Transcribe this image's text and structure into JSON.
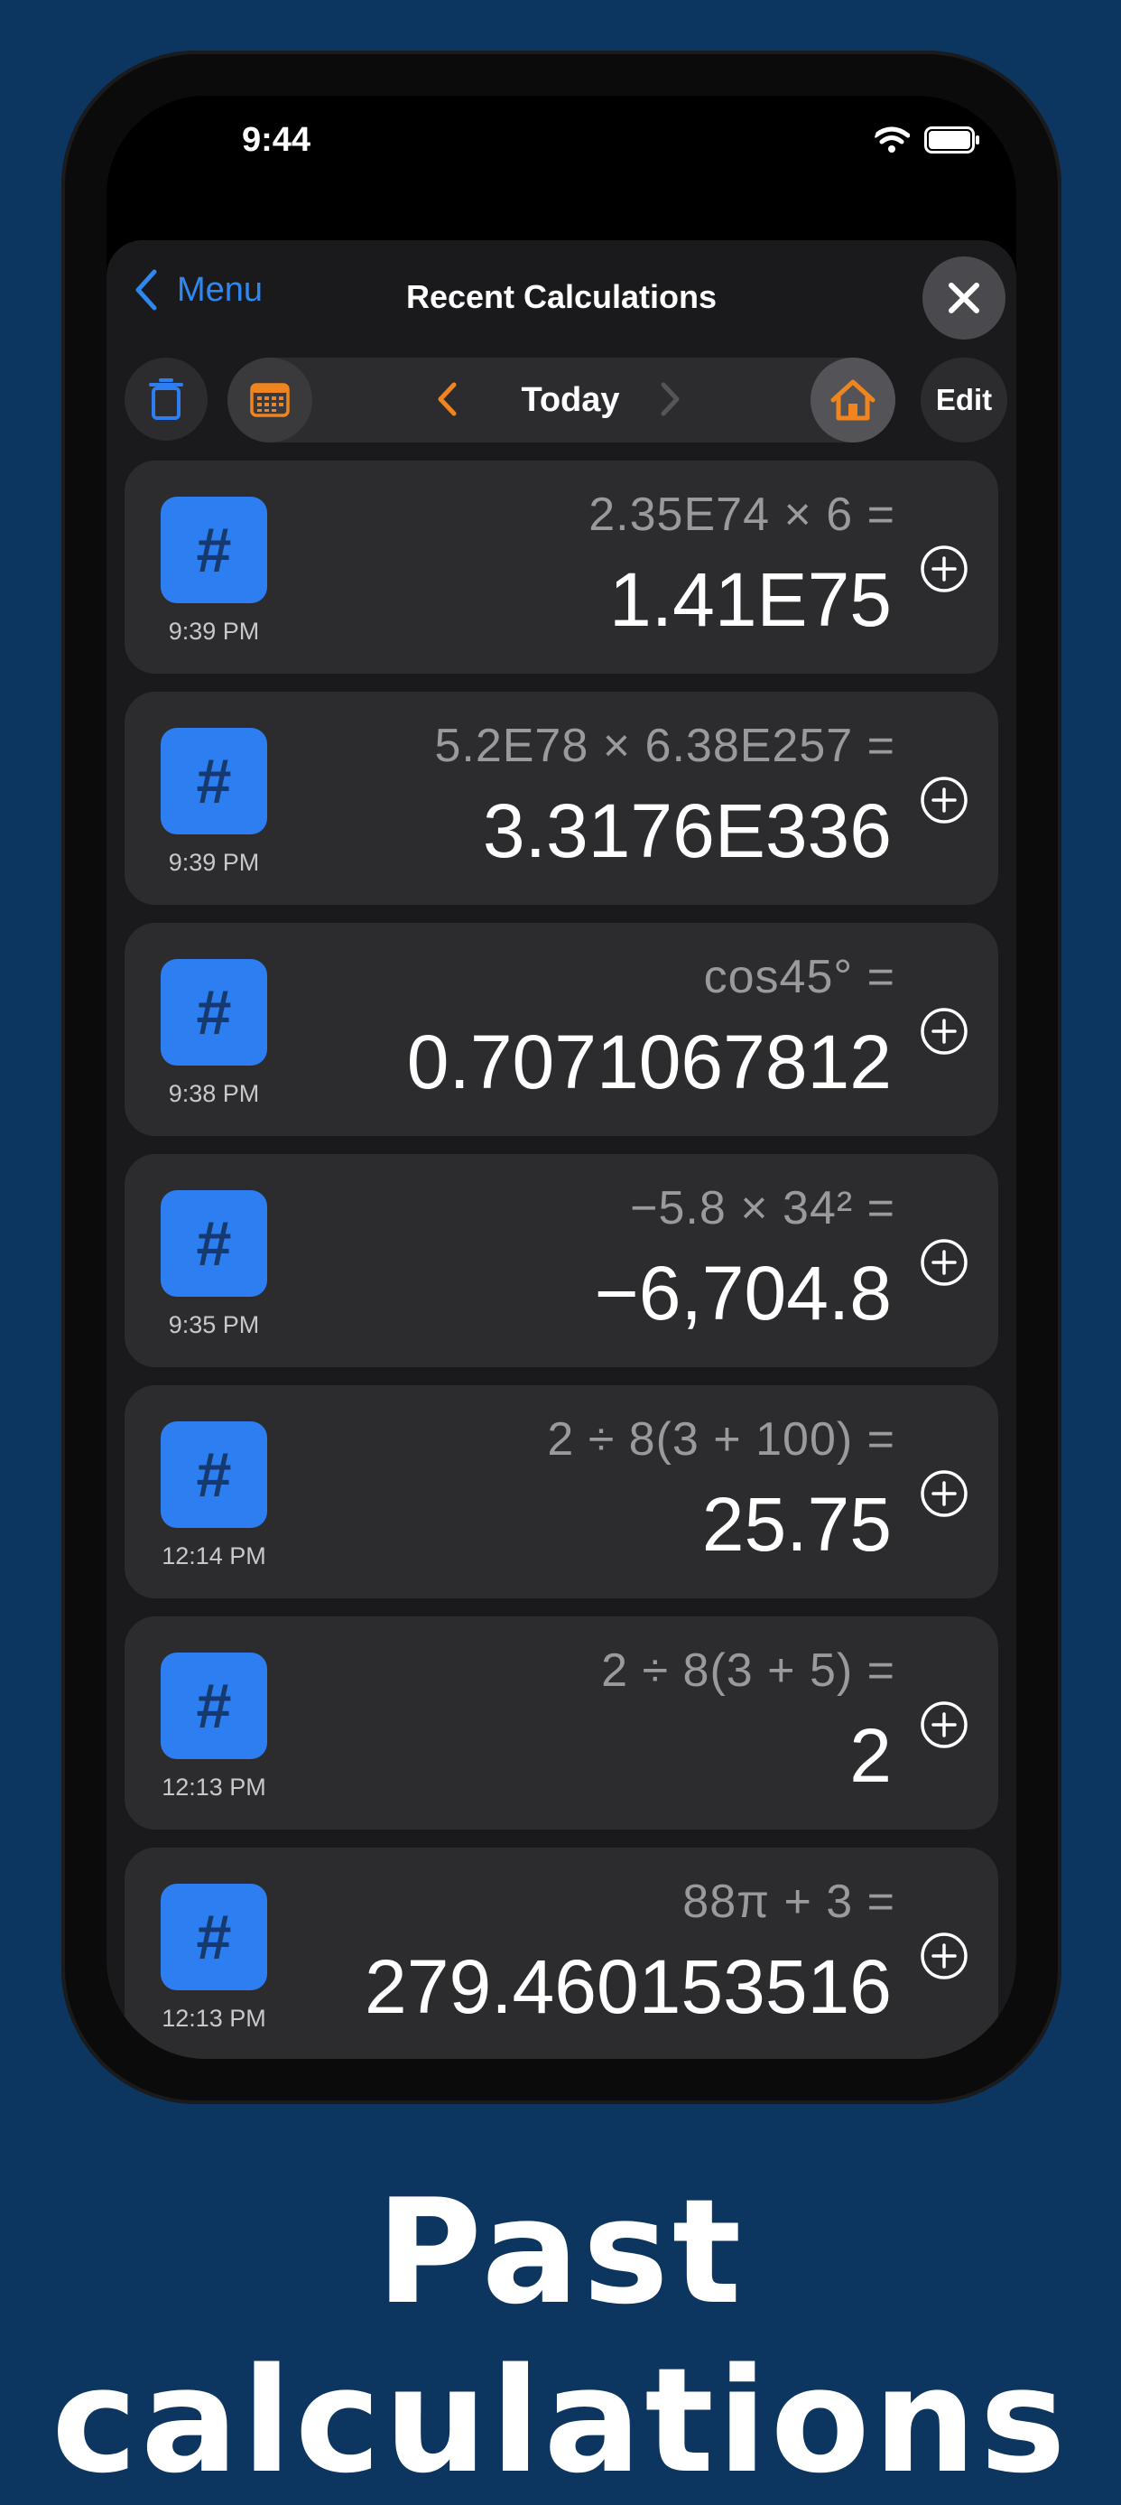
{
  "status_bar": {
    "time": "9:44"
  },
  "nav": {
    "back_label": "Menu",
    "title": "Recent Calculations"
  },
  "toolbar": {
    "date_label": "Today",
    "edit_label": "Edit"
  },
  "calculations": [
    {
      "expression": "2.35E74 × 6 =",
      "result": "1.41E75",
      "time": "9:39 PM"
    },
    {
      "expression": "5.2E78 × 6.38E257 =",
      "result": "3.3176E336",
      "time": "9:39 PM"
    },
    {
      "expression": "cos45° =",
      "result": "0.7071067812",
      "time": "9:38 PM"
    },
    {
      "expression": "−5.8 × 34² =",
      "result": "−6,704.8",
      "time": "9:35 PM"
    },
    {
      "expression": "2 ÷ 8(3 + 100) =",
      "result": "25.75",
      "time": "12:14 PM"
    },
    {
      "expression": "2 ÷ 8(3 + 5) =",
      "result": "2",
      "time": "12:13 PM"
    },
    {
      "expression": "88π + 3 =",
      "result": "279.460153516",
      "time": "12:13 PM"
    }
  ],
  "tile_symbol": "#",
  "caption": "Past calculations",
  "colors": {
    "background": "#0c3560",
    "accent_blue": "#2e88f0",
    "accent_orange": "#f0841e",
    "card": "#2c2c2e",
    "tile": "#2d7ef0"
  },
  "icons": {
    "back": "chevron-left-icon",
    "close": "close-icon",
    "trash": "trash-icon",
    "calendar": "calendar-icon",
    "home": "home-icon",
    "add": "plus-circle-icon"
  }
}
